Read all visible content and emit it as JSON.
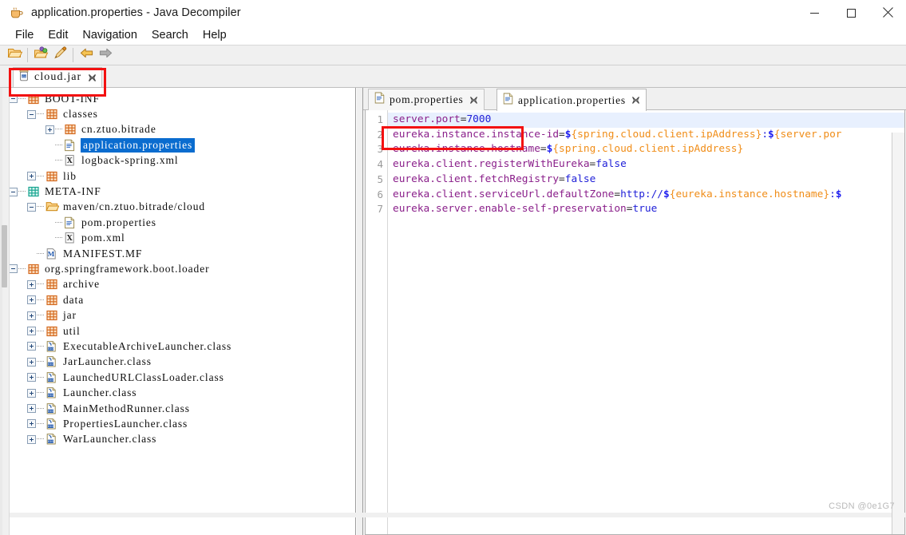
{
  "window": {
    "title": "application.properties - Java Decompiler",
    "icon": "coffee-cup-icon",
    "minimize_label": "Minimize",
    "maximize_label": "Maximize",
    "close_label": "Close"
  },
  "menubar": {
    "items": [
      {
        "label": "File"
      },
      {
        "label": "Edit"
      },
      {
        "label": "Navigation"
      },
      {
        "label": "Search"
      },
      {
        "label": "Help"
      }
    ]
  },
  "toolbar": {
    "buttons": [
      {
        "name": "open-folder-icon",
        "tooltip": "Open File"
      },
      {
        "name": "open-recent-folder-icon",
        "tooltip": "Open Recent"
      },
      {
        "name": "wand-icon",
        "tooltip": "Preferences"
      },
      {
        "name": "back-arrow-icon",
        "tooltip": "Back"
      },
      {
        "name": "forward-arrow-icon",
        "tooltip": "Forward"
      }
    ]
  },
  "jar_tabs": [
    {
      "label": "cloud.jar",
      "icon": "jar-icon",
      "close": "✕",
      "active": true
    }
  ],
  "tree": {
    "nodes": [
      {
        "label": "BOOT-INF",
        "depth": 0,
        "expander": "minus",
        "icon": "package-icon",
        "selected": false
      },
      {
        "label": "classes",
        "depth": 1,
        "expander": "minus",
        "icon": "package-icon",
        "selected": false
      },
      {
        "label": "cn.ztuo.bitrade",
        "depth": 2,
        "expander": "plus",
        "icon": "package-icon",
        "selected": false
      },
      {
        "label": "application.properties",
        "depth": 2,
        "expander": "none",
        "icon": "properties-icon",
        "selected": true
      },
      {
        "label": "logback-spring.xml",
        "depth": 2,
        "expander": "none",
        "icon": "xml-icon",
        "selected": false
      },
      {
        "label": "lib",
        "depth": 1,
        "expander": "plus",
        "icon": "package-icon",
        "selected": false
      },
      {
        "label": "META-INF",
        "depth": 0,
        "expander": "minus",
        "icon": "package-teal-icon",
        "selected": false
      },
      {
        "label": "maven/cn.ztuo.bitrade/cloud",
        "depth": 1,
        "expander": "minus",
        "icon": "folder-icon",
        "selected": false
      },
      {
        "label": "pom.properties",
        "depth": 2,
        "expander": "none",
        "icon": "properties-icon",
        "selected": false
      },
      {
        "label": "pom.xml",
        "depth": 2,
        "expander": "none",
        "icon": "xml-icon",
        "selected": false
      },
      {
        "label": "MANIFEST.MF",
        "depth": 1,
        "expander": "none",
        "icon": "manifest-icon",
        "selected": false
      },
      {
        "label": "org.springframework.boot.loader",
        "depth": 0,
        "expander": "minus",
        "icon": "package-icon",
        "selected": false
      },
      {
        "label": "archive",
        "depth": 1,
        "expander": "plus",
        "icon": "package-icon",
        "selected": false
      },
      {
        "label": "data",
        "depth": 1,
        "expander": "plus",
        "icon": "package-icon",
        "selected": false
      },
      {
        "label": "jar",
        "depth": 1,
        "expander": "plus",
        "icon": "package-icon",
        "selected": false
      },
      {
        "label": "util",
        "depth": 1,
        "expander": "plus",
        "icon": "package-icon",
        "selected": false
      },
      {
        "label": "ExecutableArchiveLauncher.class",
        "depth": 1,
        "expander": "plus",
        "icon": "class-icon",
        "selected": false
      },
      {
        "label": "JarLauncher.class",
        "depth": 1,
        "expander": "plus",
        "icon": "class-icon",
        "selected": false
      },
      {
        "label": "LaunchedURLClassLoader.class",
        "depth": 1,
        "expander": "plus",
        "icon": "class-icon",
        "selected": false
      },
      {
        "label": "Launcher.class",
        "depth": 1,
        "expander": "plus",
        "icon": "class-icon",
        "selected": false
      },
      {
        "label": "MainMethodRunner.class",
        "depth": 1,
        "expander": "plus",
        "icon": "class-icon",
        "selected": false
      },
      {
        "label": "PropertiesLauncher.class",
        "depth": 1,
        "expander": "plus",
        "icon": "class-icon",
        "selected": false
      },
      {
        "label": "WarLauncher.class",
        "depth": 1,
        "expander": "plus",
        "icon": "class-icon",
        "selected": false
      }
    ]
  },
  "editor": {
    "tabs": [
      {
        "label": "pom.properties",
        "icon": "properties-icon",
        "close": "✕",
        "active": false
      },
      {
        "label": "application.properties",
        "icon": "properties-icon",
        "close": "✕",
        "active": true
      }
    ],
    "line_numbers": [
      "1",
      "2",
      "3",
      "4",
      "5",
      "6",
      "7"
    ],
    "lines": [
      {
        "n": 1,
        "current": true,
        "text": "server.port=7000"
      },
      {
        "n": 2,
        "current": false,
        "text": "eureka.instance.instance-id=${spring.cloud.client.ipAddress}:${server.por"
      },
      {
        "n": 3,
        "current": false,
        "text": "eureka.instance.hostname=${spring.cloud.client.ipAddress}"
      },
      {
        "n": 4,
        "current": false,
        "text": "eureka.client.registerWithEureka=false"
      },
      {
        "n": 5,
        "current": false,
        "text": "eureka.client.fetchRegistry=false"
      },
      {
        "n": 6,
        "current": false,
        "text": "eureka.client.serviceUrl.defaultZone=http://${eureka.instance.hostname}:$"
      },
      {
        "n": 7,
        "current": false,
        "text": "eureka.server.enable-self-preservation=true"
      }
    ]
  },
  "annotations": {
    "jar_tab_highlight": {
      "color": "#f31111",
      "target": "cloud.jar"
    },
    "code_highlight": {
      "color": "#f31111",
      "target": "server.port=7000"
    }
  },
  "watermark": {
    "text": "CSDN @0e1G7"
  },
  "colors": {
    "accent_selection": "#0a6ccf",
    "annotation_red": "#f31111",
    "code_key": "#8a1f8a",
    "code_value": "#2020d8",
    "code_expression": "#f08d18",
    "current_line": "#e8f0fe"
  }
}
